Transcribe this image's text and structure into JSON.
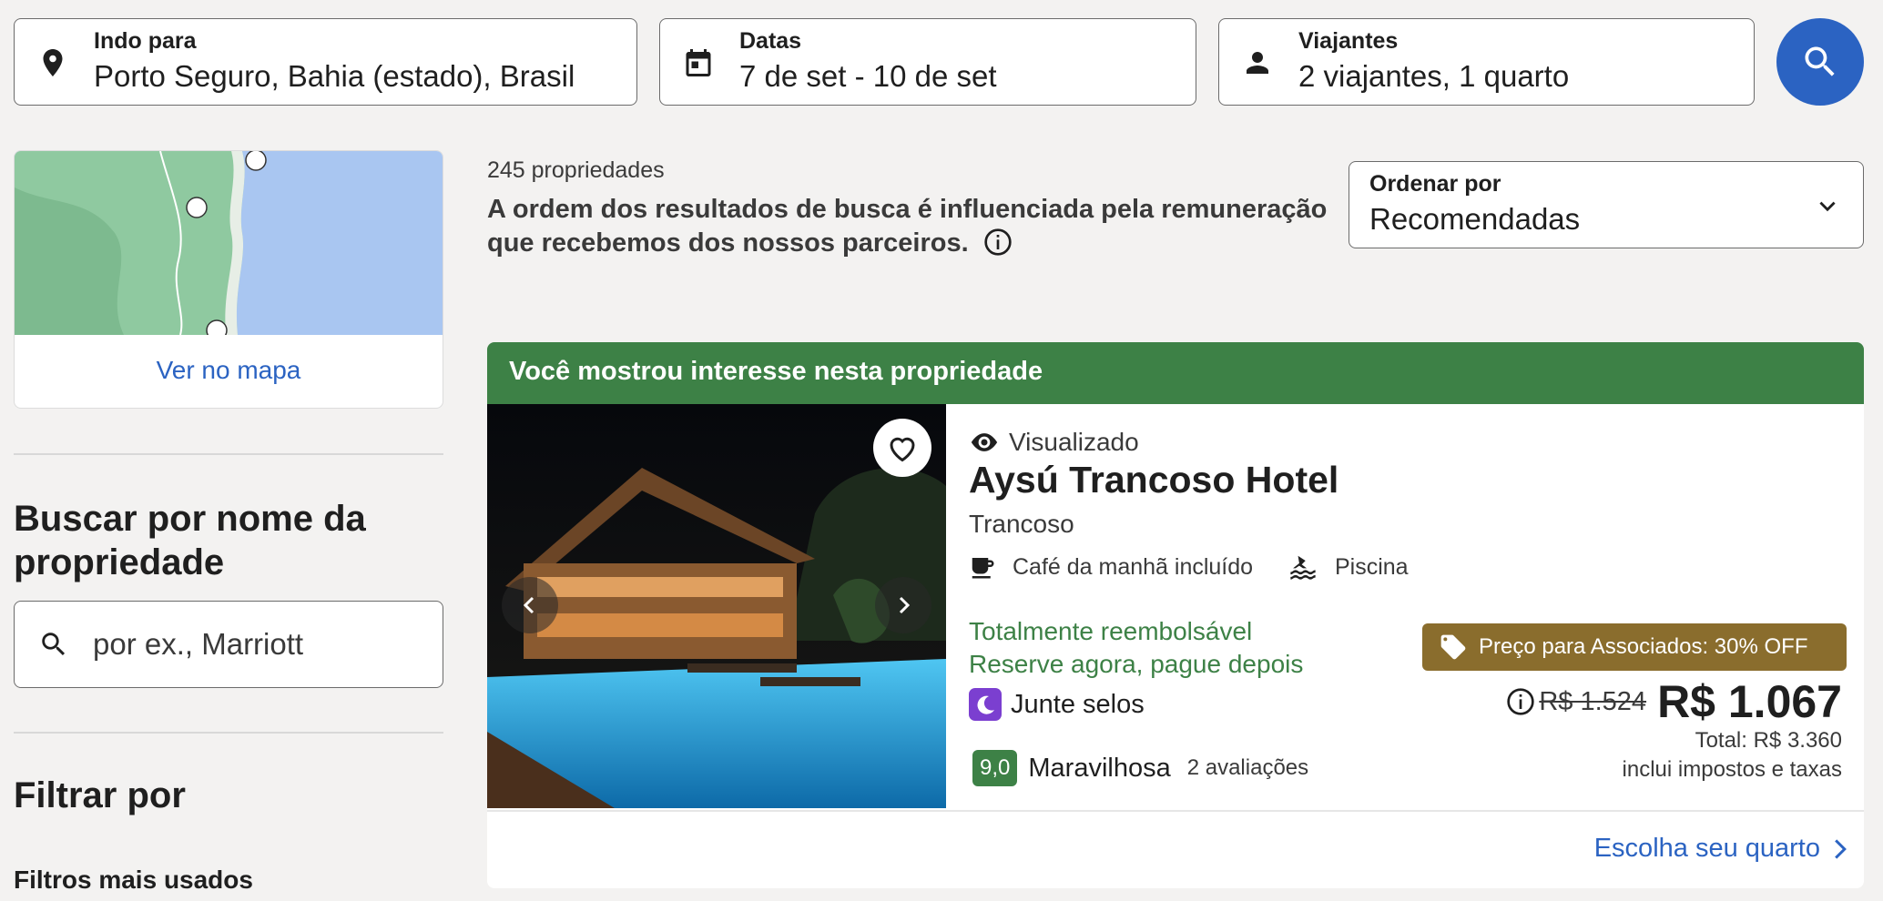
{
  "search": {
    "destination": {
      "label": "Indo para",
      "value": "Porto Seguro, Bahia (estado), Brasil"
    },
    "dates": {
      "label": "Datas",
      "value": "7 de set - 10 de set"
    },
    "travelers": {
      "label": "Viajantes",
      "value": "2 viajantes, 1 quarto"
    }
  },
  "map": {
    "link_label": "Ver no mapa"
  },
  "sidebar": {
    "search_title": "Buscar por nome da propriedade",
    "search_placeholder": "por ex., Marriott",
    "filter_title": "Filtrar por",
    "filter_subtitle": "Filtros mais usados"
  },
  "results": {
    "count": "245 propriedades",
    "disclaimer": "A ordem dos resultados de busca é influenciada pela remuneração que recebemos dos nossos parceiros."
  },
  "sort": {
    "label": "Ordenar por",
    "value": "Recomendadas"
  },
  "listing": {
    "banner": "Você mostrou interesse nesta propriedade",
    "viewed_label": "Visualizado",
    "name": "Aysú Trancoso Hotel",
    "location": "Trancoso",
    "amenities": [
      "Café da manhã incluído",
      "Piscina"
    ],
    "refund_line1": "Totalmente reembolsável",
    "refund_line2": "Reserve agora, pague depois",
    "stamps_label": "Junte selos",
    "rating_score": "9,0",
    "rating_word": "Maravilhosa",
    "review_count": "2 avaliações",
    "member_badge": "Preço para Associados: 30% OFF",
    "old_price": "R$ 1.524",
    "price": "R$ 1.067",
    "total": "Total: R$ 3.360",
    "taxes_note": "inclui impostos e taxas",
    "cta": "Escolha seu quarto"
  },
  "colors": {
    "accent": "#2b63c2",
    "green": "#3d8146",
    "badge": "#8a6d2d"
  }
}
